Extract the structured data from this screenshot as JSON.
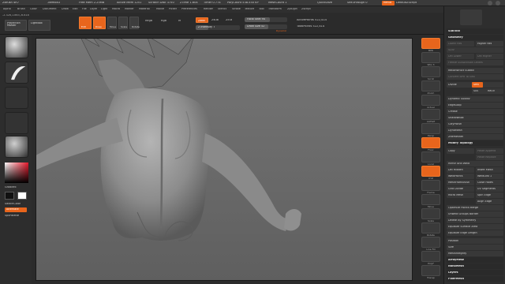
{
  "titlebar": {
    "app": "ZBrush 4R7",
    "doc": "-demo83",
    "free_mem": "Free Mem 2.25MB",
    "active_mem": "Active Mem 1251",
    "scratch": "Scratch Disk 3750",
    "ztime": "ZTime 1.604",
    "timer": "Timer 0.774",
    "polycount": "PolyCount 538.550 KP",
    "meshcount": "MeshCount 1",
    "quicksave": "QuickSave",
    "see_through": "See-through 0",
    "menus_btn": "Menus",
    "default_script": "DefaultZScript"
  },
  "menubar": {
    "items": [
      "Alpha",
      "Brush",
      "Color",
      "Document",
      "Draw",
      "Edit",
      "File",
      "Layer",
      "Light",
      "Macro",
      "Marker",
      "Material",
      "Movie",
      "Picker",
      "Preferences",
      "Render",
      "Stencil",
      "Stroke",
      "Texture",
      "Tool",
      "Transform",
      "Zplugin",
      "Zscript"
    ]
  },
  "coords": "-2.328,1.863,-6.818",
  "topshelf": {
    "projection_master": "Projection Master",
    "lightbox": "LightBox",
    "edit": "Edit",
    "draw": "Draw",
    "move": "Move",
    "scale": "Scale",
    "rotate": "Rotate",
    "mrgb": "Mrgb",
    "rgb": "Rgb",
    "m": "M",
    "zadd": "Zadd",
    "zsub": "Zsub",
    "zcut": "Zcut",
    "rgb_intensity": "Rgb Intensity",
    "z_intensity": "Z Intensity 7",
    "focal_shift": "Focal Shift 94",
    "draw_size": "Draw Size 52",
    "dynamic": "Dynamic",
    "active_points": "ActivePoints 522,414",
    "total_points": "TotalPoints 522,414",
    "z_intensity_level": 0.28,
    "focal_shift_level": 0.6,
    "draw_size_level": 0.55
  },
  "leftshelf": {
    "gradient": "Gradient",
    "switch_color": "SwitchColor",
    "alternate": "Alternate",
    "spxpalette": "SpxPalette"
  },
  "rightshelf": {
    "items": [
      "BPR",
      "SPix 3",
      "Scroll",
      "Zoom",
      "Actual",
      "AAHalf",
      "Persp",
      "Floor",
      "Local",
      "XYZ",
      "Frame",
      "Move",
      "Scale",
      "Rotate",
      "Line Fill",
      "PolyF",
      "Transp",
      "Solo",
      "Xpose"
    ]
  },
  "tray": {
    "subtool": "SubTool",
    "geometry": "Geometry",
    "higher_res": "Higher Res",
    "lower_res": "Lower Res",
    "sdiv": "SDiv",
    "del_lower": "Del Lower",
    "del_higher": "Del Higher",
    "freeze_subdivision": "Freeze SubDivision Levels",
    "reconstruct_subdiv": "Reconstruct Subdiv",
    "convert_bpr": "Convert BPR To Geo",
    "divide": "Divide",
    "smt": "Smt",
    "suv": "Suv",
    "reuv": "ReUV",
    "dynamic_subdiv": "Dynamic Subdiv",
    "edgeloop": "EdgeLoop",
    "crease": "Crease",
    "shadowbox": "ShadowBox",
    "claypolish": "ClayPolish",
    "dynamesh": "DynaMesh",
    "zremesher": "ZRemesher",
    "modify_topology": "Modify Topology",
    "copy": "Copy",
    "paste_append": "Paste Append",
    "paste_replace": "Paste Replace",
    "mirror_weld": "Mirror And Weld",
    "del_hidden": "Del Hidden",
    "insert_mesh": "Insert Mesh",
    "weld_points": "WeldPoints",
    "weld_dist": "WeldDist 1",
    "meshfromb": "MeshFromBrush",
    "close_holes": "Close Holes",
    "grid_divide": "Grid Divide",
    "uv_segments": "UV Segments",
    "micro_mesh": "Micro Mesh",
    "spin_edge": "Spin Edge",
    "align_edge": "Align Edge",
    "optimize": "Optimize Points Merge",
    "unweld": "Unweld Groups Border",
    "delete_by_symmetry": "Delete By Symmetry",
    "equalize_surface": "Equalize Surface Area",
    "equalize_edge": "Equalize Edge Length",
    "position": "Position",
    "size": "Size",
    "meshintegrity": "MeshIntegrity",
    "arraymesh": "ArrayMesh",
    "nanomesh": "NanoMesh",
    "layers": "Layers",
    "fibermesh": "FiberMesh"
  },
  "colors": {
    "accent": "#e8651c",
    "panel": "#2e2e2e",
    "viewport": "#6b6b6b",
    "model": "#9a9a9a"
  }
}
